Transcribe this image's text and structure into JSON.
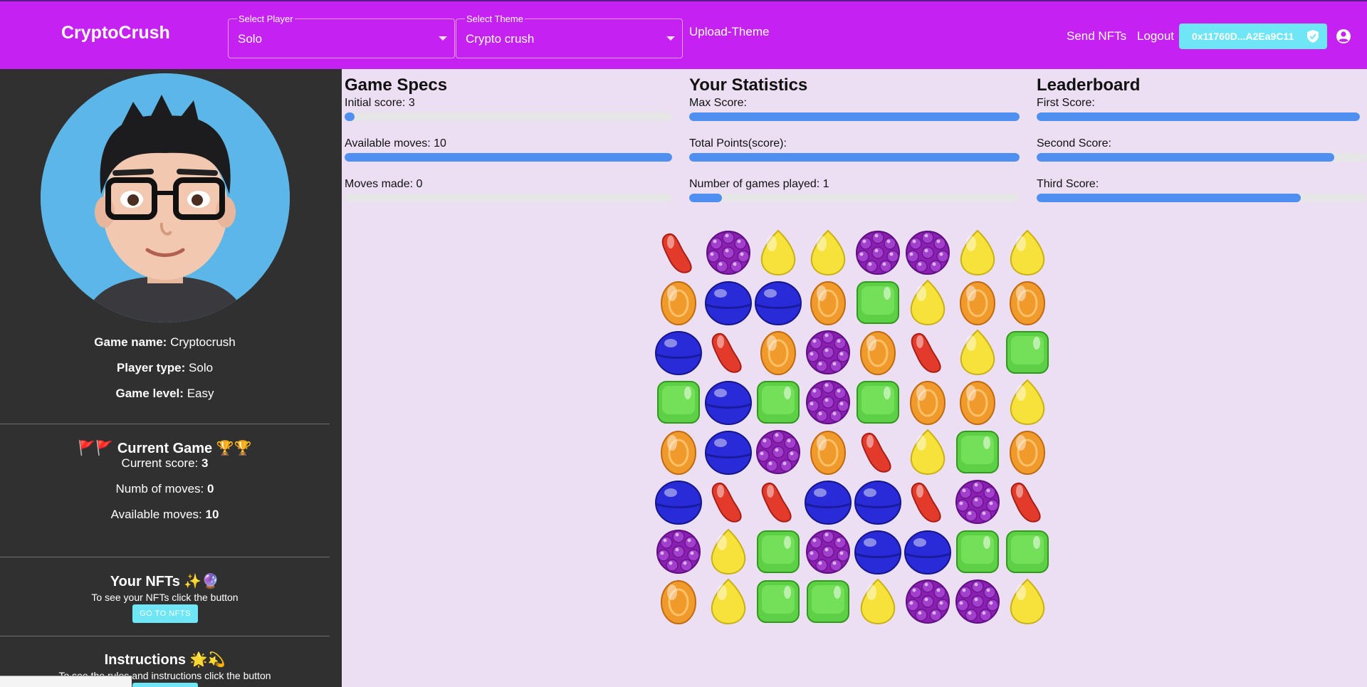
{
  "header": {
    "brand": "CryptoCrush",
    "select_player": {
      "label": "Select Player",
      "value": "Solo"
    },
    "select_theme": {
      "label": "Select Theme",
      "value": "Crypto crush"
    },
    "upload_theme": "Upload-Theme",
    "send_nfts": "Send NFTs",
    "logout": "Logout",
    "wallet": "0x11760D...A2Ea9C11"
  },
  "sidebar": {
    "game_name_label": "Game name:",
    "game_name": "Cryptocrush",
    "player_type_label": "Player type:",
    "player_type": "Solo",
    "game_level_label": "Game level:",
    "game_level": "Easy",
    "current_game_title": "🚩🚩 Current Game 🏆🏆",
    "current_score_label": "Current score:",
    "current_score": "3",
    "num_moves_label": "Numb of moves:",
    "num_moves": "0",
    "available_moves_label": "Available moves:",
    "available_moves": "10",
    "nfts_title": "Your NFTs ✨🔮",
    "nfts_text": "To see your NFTs click the button",
    "nfts_button": "GO TO NFTS",
    "instructions_title": "Instructions 🌟💫",
    "instructions_text": "To see the rules and instructions click the button"
  },
  "specs": {
    "title": "Game Specs",
    "initial_score": "Initial score: 3",
    "initial_score_fill": 0.03,
    "available_moves": "Available moves: 10",
    "available_moves_fill": 1.0,
    "moves_made": "Moves made: 0",
    "moves_made_fill": 0.0
  },
  "stats": {
    "title": "Your Statistics",
    "max_score": "Max Score:",
    "max_score_fill": 1.0,
    "total_points": "Total Points(score):",
    "total_points_fill": 1.0,
    "games_played": "Number of games played: 1",
    "games_played_fill": 0.1
  },
  "leaderboard": {
    "title": "Leaderboard",
    "first": "First Score:",
    "first_fill": 1.0,
    "second": "Second Score:",
    "second_fill": 0.9,
    "third": "Third Score:",
    "third_fill": 0.8
  },
  "colors": {
    "header": "#c521f1",
    "accent": "#6ee6f6",
    "bar_fill": "#4f8ff0"
  },
  "board": {
    "rows": [
      [
        "red",
        "purple",
        "yellow",
        "yellow",
        "purple",
        "purple",
        "yellow",
        "yellow"
      ],
      [
        "orange",
        "blue",
        "blue",
        "orange",
        "green",
        "yellow",
        "orange",
        "orange"
      ],
      [
        "blue",
        "red",
        "orange",
        "purple",
        "orange",
        "red",
        "yellow",
        "green"
      ],
      [
        "green",
        "blue",
        "green",
        "purple",
        "green",
        "orange",
        "orange",
        "yellow"
      ],
      [
        "orange",
        "blue",
        "purple",
        "orange",
        "red",
        "yellow",
        "green",
        "orange"
      ],
      [
        "blue",
        "red",
        "red",
        "blue",
        "blue",
        "red",
        "purple",
        "red"
      ],
      [
        "purple",
        "yellow",
        "green",
        "purple",
        "blue",
        "blue",
        "green",
        "green"
      ],
      [
        "orange",
        "yellow",
        "green",
        "green",
        "yellow",
        "purple",
        "purple",
        "yellow"
      ]
    ]
  }
}
